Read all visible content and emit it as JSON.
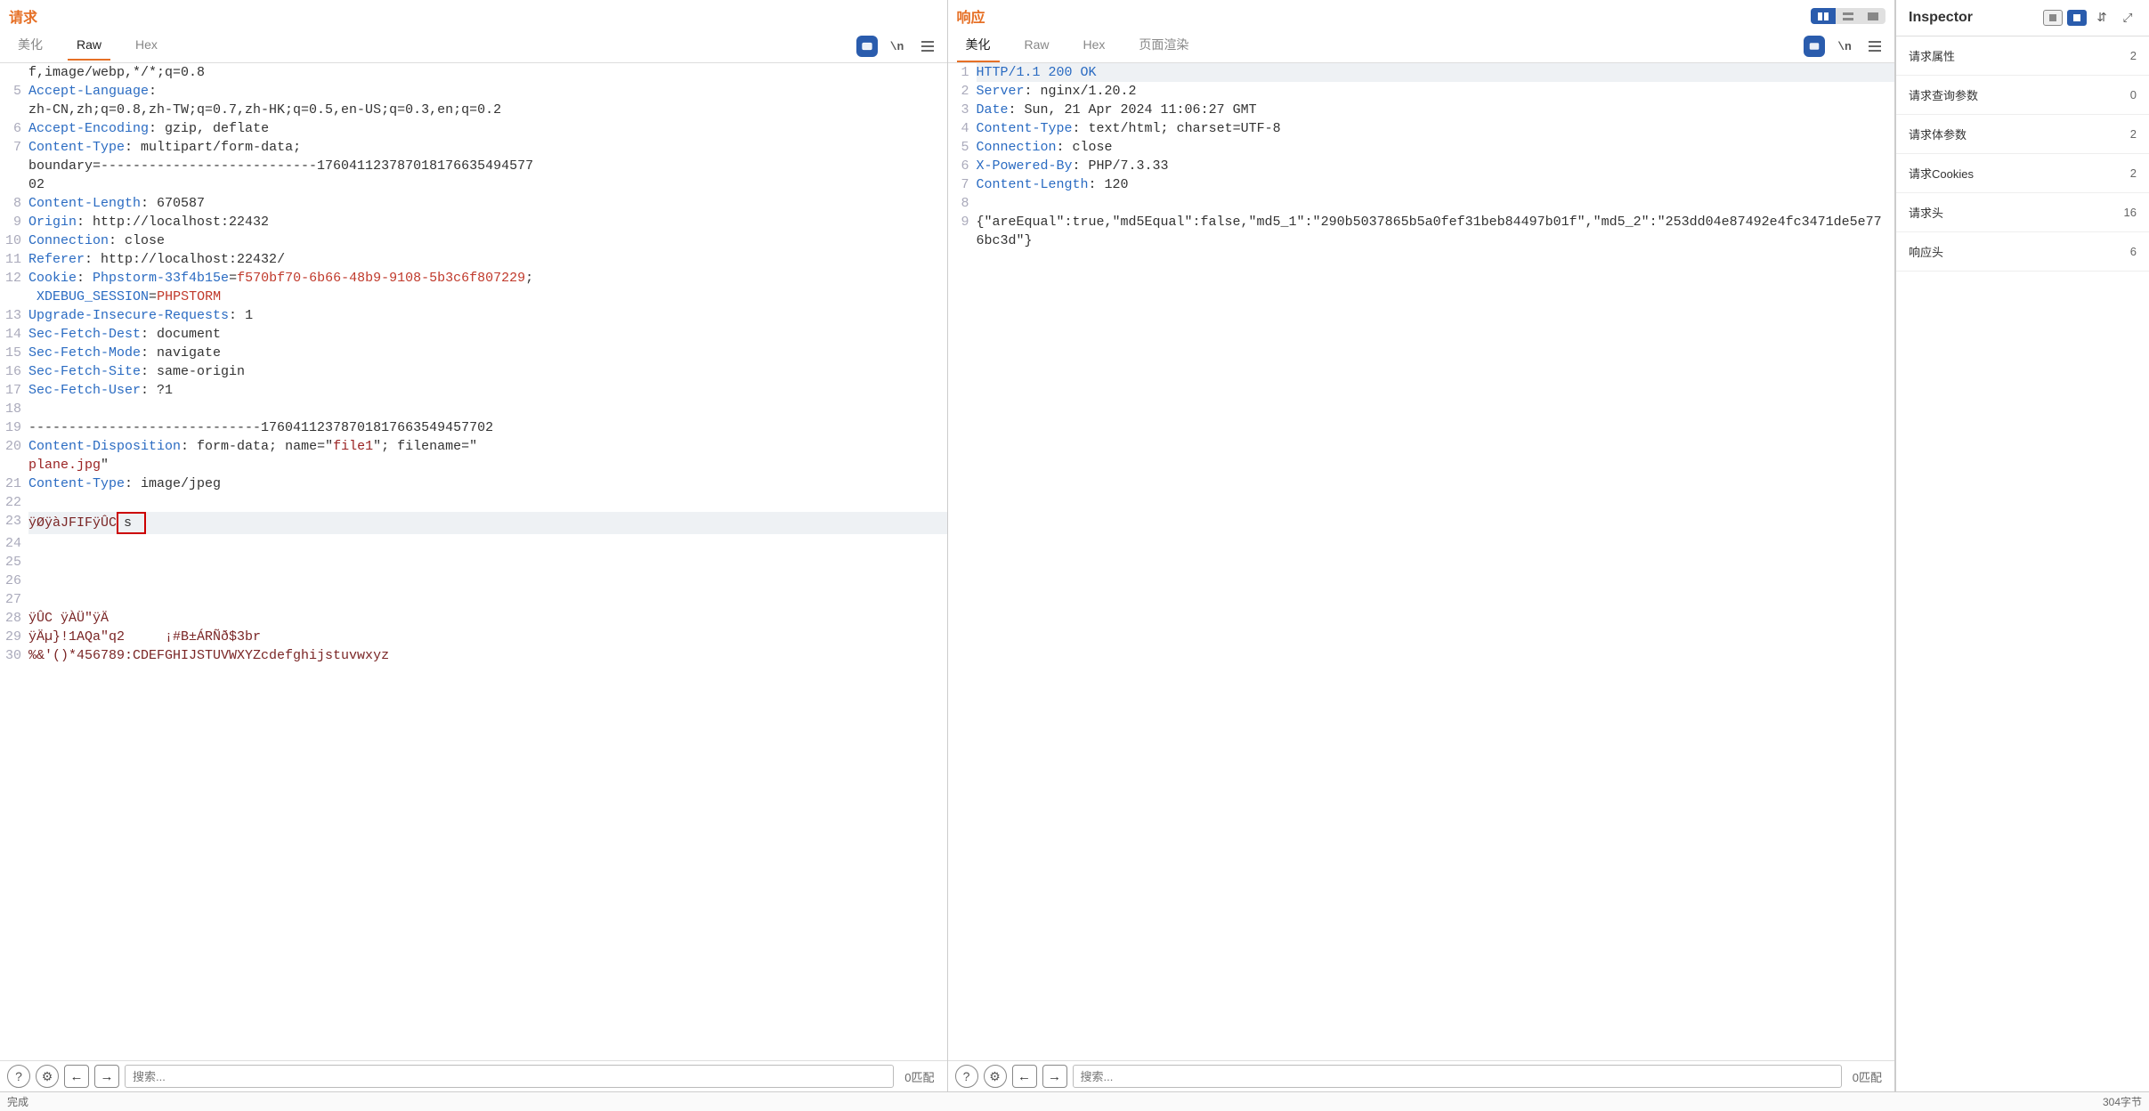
{
  "request": {
    "title": "请求",
    "tabs": [
      "美化",
      "Raw",
      "Hex"
    ],
    "active_tab": 1,
    "lines": [
      {
        "n": "",
        "html": [
          {
            "c": "val",
            "t": "f,image/webp,*/*;q=0.8"
          }
        ]
      },
      {
        "n": "5",
        "html": [
          {
            "c": "hdr",
            "t": "Accept-Language"
          },
          {
            "c": "",
            "t": ":"
          }
        ]
      },
      {
        "n": "",
        "html": [
          {
            "c": "val",
            "t": "zh-CN,zh;q=0.8,zh-TW;q=0.7,zh-HK;q=0.5,en-US;q=0.3,en;q=0.2"
          }
        ]
      },
      {
        "n": "6",
        "html": [
          {
            "c": "hdr",
            "t": "Accept-Encoding"
          },
          {
            "c": "",
            "t": ": "
          },
          {
            "c": "val",
            "t": "gzip, deflate"
          }
        ]
      },
      {
        "n": "7",
        "html": [
          {
            "c": "hdr",
            "t": "Content-Type"
          },
          {
            "c": "",
            "t": ": "
          },
          {
            "c": "val",
            "t": "multipart/form-data;"
          }
        ]
      },
      {
        "n": "",
        "html": [
          {
            "c": "val",
            "t": "boundary=---------------------------176041123787018176635494577"
          }
        ]
      },
      {
        "n": "",
        "html": [
          {
            "c": "val",
            "t": "02"
          }
        ]
      },
      {
        "n": "8",
        "html": [
          {
            "c": "hdr",
            "t": "Content-Length"
          },
          {
            "c": "",
            "t": ": "
          },
          {
            "c": "val",
            "t": "670587"
          }
        ]
      },
      {
        "n": "9",
        "html": [
          {
            "c": "hdr",
            "t": "Origin"
          },
          {
            "c": "",
            "t": ": "
          },
          {
            "c": "val",
            "t": "http://localhost:22432"
          }
        ]
      },
      {
        "n": "10",
        "html": [
          {
            "c": "hdr",
            "t": "Connection"
          },
          {
            "c": "",
            "t": ": "
          },
          {
            "c": "val",
            "t": "close"
          }
        ]
      },
      {
        "n": "11",
        "html": [
          {
            "c": "hdr",
            "t": "Referer"
          },
          {
            "c": "",
            "t": ": "
          },
          {
            "c": "val",
            "t": "http://localhost:22432/"
          }
        ]
      },
      {
        "n": "12",
        "html": [
          {
            "c": "hdr",
            "t": "Cookie"
          },
          {
            "c": "",
            "t": ": "
          },
          {
            "c": "ck-name",
            "t": "Phpstorm-33f4b15e"
          },
          {
            "c": "",
            "t": "="
          },
          {
            "c": "ck-val",
            "t": "f570bf70-6b66-48b9-9108-5b3c6f807229"
          },
          {
            "c": "",
            "t": ";"
          }
        ]
      },
      {
        "n": "",
        "html": [
          {
            "c": "",
            "t": " "
          },
          {
            "c": "ck-name",
            "t": "XDEBUG_SESSION"
          },
          {
            "c": "",
            "t": "="
          },
          {
            "c": "ck-val",
            "t": "PHPSTORM"
          }
        ]
      },
      {
        "n": "13",
        "html": [
          {
            "c": "hdr",
            "t": "Upgrade-Insecure-Requests"
          },
          {
            "c": "",
            "t": ": "
          },
          {
            "c": "val",
            "t": "1"
          }
        ]
      },
      {
        "n": "14",
        "html": [
          {
            "c": "hdr",
            "t": "Sec-Fetch-Dest"
          },
          {
            "c": "",
            "t": ": "
          },
          {
            "c": "val",
            "t": "document"
          }
        ]
      },
      {
        "n": "15",
        "html": [
          {
            "c": "hdr",
            "t": "Sec-Fetch-Mode"
          },
          {
            "c": "",
            "t": ": "
          },
          {
            "c": "val",
            "t": "navigate"
          }
        ]
      },
      {
        "n": "16",
        "html": [
          {
            "c": "hdr",
            "t": "Sec-Fetch-Site"
          },
          {
            "c": "",
            "t": ": "
          },
          {
            "c": "val",
            "t": "same-origin"
          }
        ]
      },
      {
        "n": "17",
        "html": [
          {
            "c": "hdr",
            "t": "Sec-Fetch-User"
          },
          {
            "c": "",
            "t": ": "
          },
          {
            "c": "val",
            "t": "?1"
          }
        ]
      },
      {
        "n": "18",
        "html": []
      },
      {
        "n": "19",
        "html": [
          {
            "c": "val",
            "t": "-----------------------------17604112378701817663549457702"
          }
        ]
      },
      {
        "n": "20",
        "html": [
          {
            "c": "hdr",
            "t": "Content-Disposition"
          },
          {
            "c": "",
            "t": ": "
          },
          {
            "c": "val",
            "t": "form-data; name=\""
          },
          {
            "c": "str",
            "t": "file1"
          },
          {
            "c": "val",
            "t": "\"; filename=\""
          }
        ]
      },
      {
        "n": "",
        "html": [
          {
            "c": "str",
            "t": "plane.jpg"
          },
          {
            "c": "val",
            "t": "\""
          }
        ]
      },
      {
        "n": "21",
        "html": [
          {
            "c": "hdr",
            "t": "Content-Type"
          },
          {
            "c": "",
            "t": ": "
          },
          {
            "c": "val",
            "t": "image/jpeg"
          }
        ]
      },
      {
        "n": "22",
        "html": []
      },
      {
        "n": "23",
        "sel": true,
        "html": [
          {
            "c": "bin",
            "t": "ÿØÿàJFIFÿÛC"
          },
          {
            "box": true,
            "t": "s"
          }
        ]
      },
      {
        "n": "24",
        "html": []
      },
      {
        "n": "25",
        "html": []
      },
      {
        "n": "26",
        "html": []
      },
      {
        "n": "27",
        "html": []
      },
      {
        "n": "28",
        "html": [
          {
            "c": "bin",
            "t": "ÿÛC ÿÀÜ\"ÿÄ"
          }
        ]
      },
      {
        "n": "29",
        "html": [
          {
            "c": "bin",
            "t": "ÿÄµ}!1AQa\"q2     ¡#B±ÁRÑð$3br"
          }
        ]
      },
      {
        "n": "30",
        "html": [
          {
            "c": "bin",
            "t": "%&'()*456789:CDEFGHIJSTUVWXYZcdefghijstuvwxyz"
          }
        ]
      }
    ],
    "search_placeholder": "搜索...",
    "match": "0匹配"
  },
  "response": {
    "title": "响应",
    "tabs": [
      "美化",
      "Raw",
      "Hex",
      "页面渲染"
    ],
    "active_tab": 0,
    "lines": [
      {
        "n": "1",
        "sel": true,
        "html": [
          {
            "c": "hdr",
            "t": "HTTP/1.1 200 OK"
          }
        ]
      },
      {
        "n": "2",
        "html": [
          {
            "c": "hdr",
            "t": "Server"
          },
          {
            "c": "",
            "t": ": "
          },
          {
            "c": "val",
            "t": "nginx/1.20.2"
          }
        ]
      },
      {
        "n": "3",
        "html": [
          {
            "c": "hdr",
            "t": "Date"
          },
          {
            "c": "",
            "t": ": "
          },
          {
            "c": "val",
            "t": "Sun, 21 Apr 2024 11:06:27 GMT"
          }
        ]
      },
      {
        "n": "4",
        "html": [
          {
            "c": "hdr",
            "t": "Content-Type"
          },
          {
            "c": "",
            "t": ": "
          },
          {
            "c": "val",
            "t": "text/html; charset=UTF-8"
          }
        ]
      },
      {
        "n": "5",
        "html": [
          {
            "c": "hdr",
            "t": "Connection"
          },
          {
            "c": "",
            "t": ": "
          },
          {
            "c": "val",
            "t": "close"
          }
        ]
      },
      {
        "n": "6",
        "html": [
          {
            "c": "hdr",
            "t": "X-Powered-By"
          },
          {
            "c": "",
            "t": ": "
          },
          {
            "c": "val",
            "t": "PHP/7.3.33"
          }
        ]
      },
      {
        "n": "7",
        "html": [
          {
            "c": "hdr",
            "t": "Content-Length"
          },
          {
            "c": "",
            "t": ": "
          },
          {
            "c": "val",
            "t": "120"
          }
        ]
      },
      {
        "n": "8",
        "html": []
      },
      {
        "n": "9",
        "html": [
          {
            "c": "val",
            "t": "{\"areEqual\":true,\"md5Equal\":false,\"md5_1\":\"290b5037865b5a0fef31beb84497b01f\",\"md5_2\":\"253dd04e87492e4fc3471de5e776bc3d\"}"
          }
        ]
      }
    ],
    "search_placeholder": "搜索...",
    "match": "0匹配"
  },
  "inspector": {
    "title": "Inspector",
    "rows": [
      {
        "label": "请求属性",
        "count": "2"
      },
      {
        "label": "请求查询参数",
        "count": "0"
      },
      {
        "label": "请求体参数",
        "count": "2"
      },
      {
        "label": "请求Cookies",
        "count": "2"
      },
      {
        "label": "请求头",
        "count": "16"
      },
      {
        "label": "响应头",
        "count": "6"
      }
    ]
  },
  "status": {
    "left": "完成",
    "right": "304字节"
  },
  "newline_label": "\\n"
}
